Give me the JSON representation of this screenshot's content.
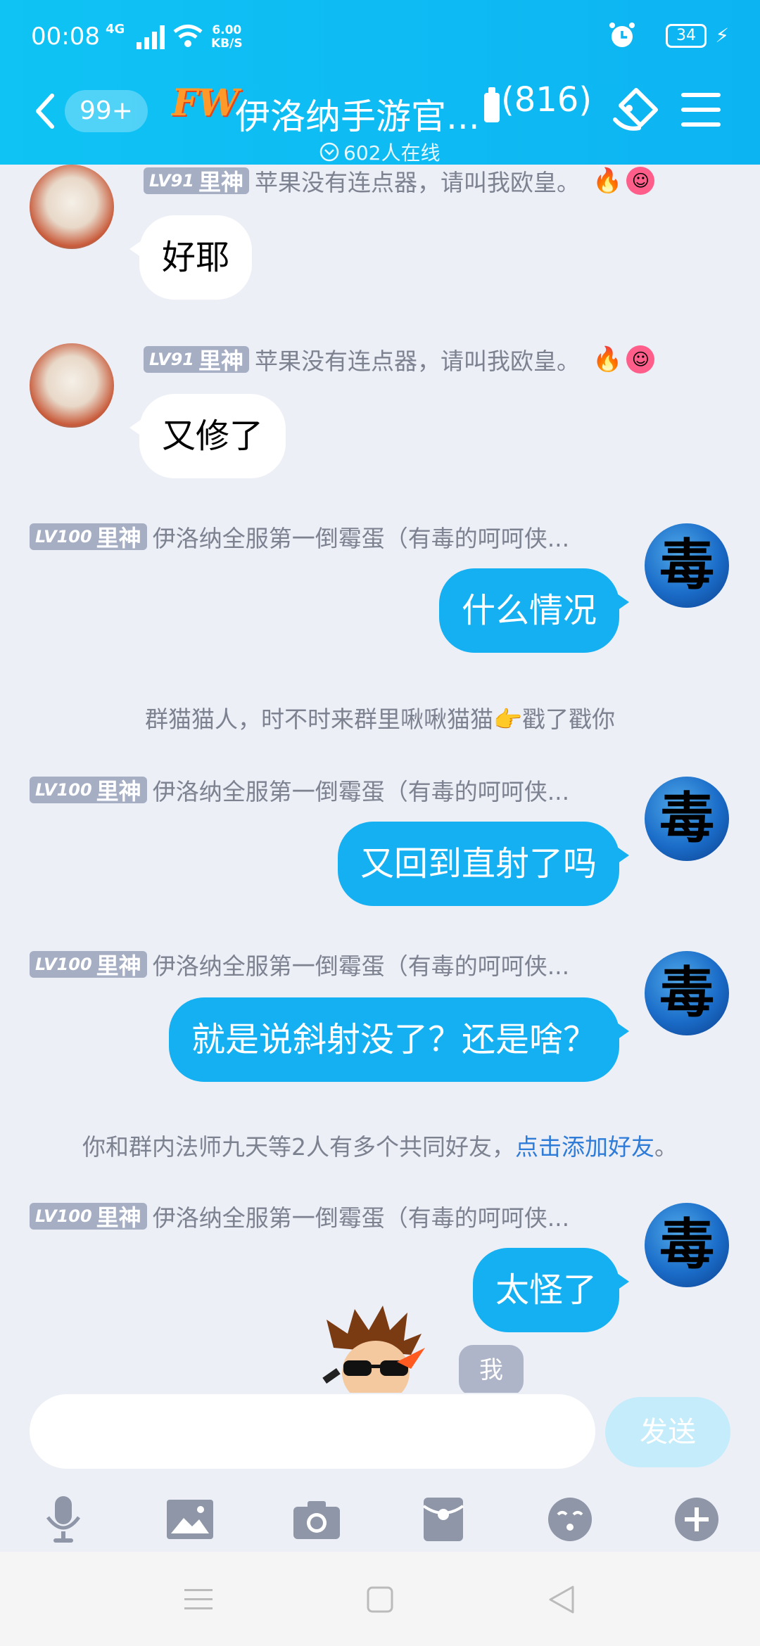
{
  "status_bar": {
    "time": "00:08",
    "network": "4G",
    "speed_value": "6.00",
    "speed_unit": "KB/S",
    "battery": "34"
  },
  "header": {
    "unread": "99+",
    "logo": "FW",
    "group_name": "伊洛纳手游官...",
    "member_count": "(816)",
    "online": "602人在线"
  },
  "messages": [
    {
      "level": "LV91",
      "title": "里神",
      "nick": "苹果没有连点器，请叫我欧皇。",
      "text": "好耶"
    },
    {
      "level": "LV91",
      "title": "里神",
      "nick": "苹果没有连点器，请叫我欧皇。",
      "text": "又修了"
    },
    {
      "level": "LV100",
      "title": "里神",
      "nick": "伊洛纳全服第一倒霉蛋（有毒的呵呵侠...",
      "text": "什么情况"
    },
    {
      "level": "LV100",
      "title": "里神",
      "nick": "伊洛纳全服第一倒霉蛋（有毒的呵呵侠...",
      "text": "又回到直射了吗"
    },
    {
      "level": "LV100",
      "title": "里神",
      "nick": "伊洛纳全服第一倒霉蛋（有毒的呵呵侠...",
      "text": "就是说斜射没了？还是啥？"
    },
    {
      "level": "LV100",
      "title": "里神",
      "nick": "伊洛纳全服第一倒霉蛋（有毒的呵呵侠...",
      "text": "太怪了"
    }
  ],
  "avatar_right_glyph": "毒",
  "system": {
    "poke_prefix": "群猫猫人，时不时来群里啾啾猫猫",
    "poke_suffix": "戳了戳你",
    "friends_text": "你和群内法师九天等2人有多个共同好友，",
    "friends_link": "点击添加好友",
    "friends_end": "。"
  },
  "sticker_label": "我",
  "input": {
    "placeholder": "",
    "send_label": "发送"
  },
  "toolbar_icons": [
    "microphone-icon",
    "image-icon",
    "camera-icon",
    "red-packet-icon",
    "emoji-icon",
    "plus-icon"
  ],
  "colors": {
    "header": "#0FC3F4",
    "bubble_out": "#15B0F2",
    "link": "#2F7CD8",
    "chat_bg": "#EDEFF7"
  }
}
